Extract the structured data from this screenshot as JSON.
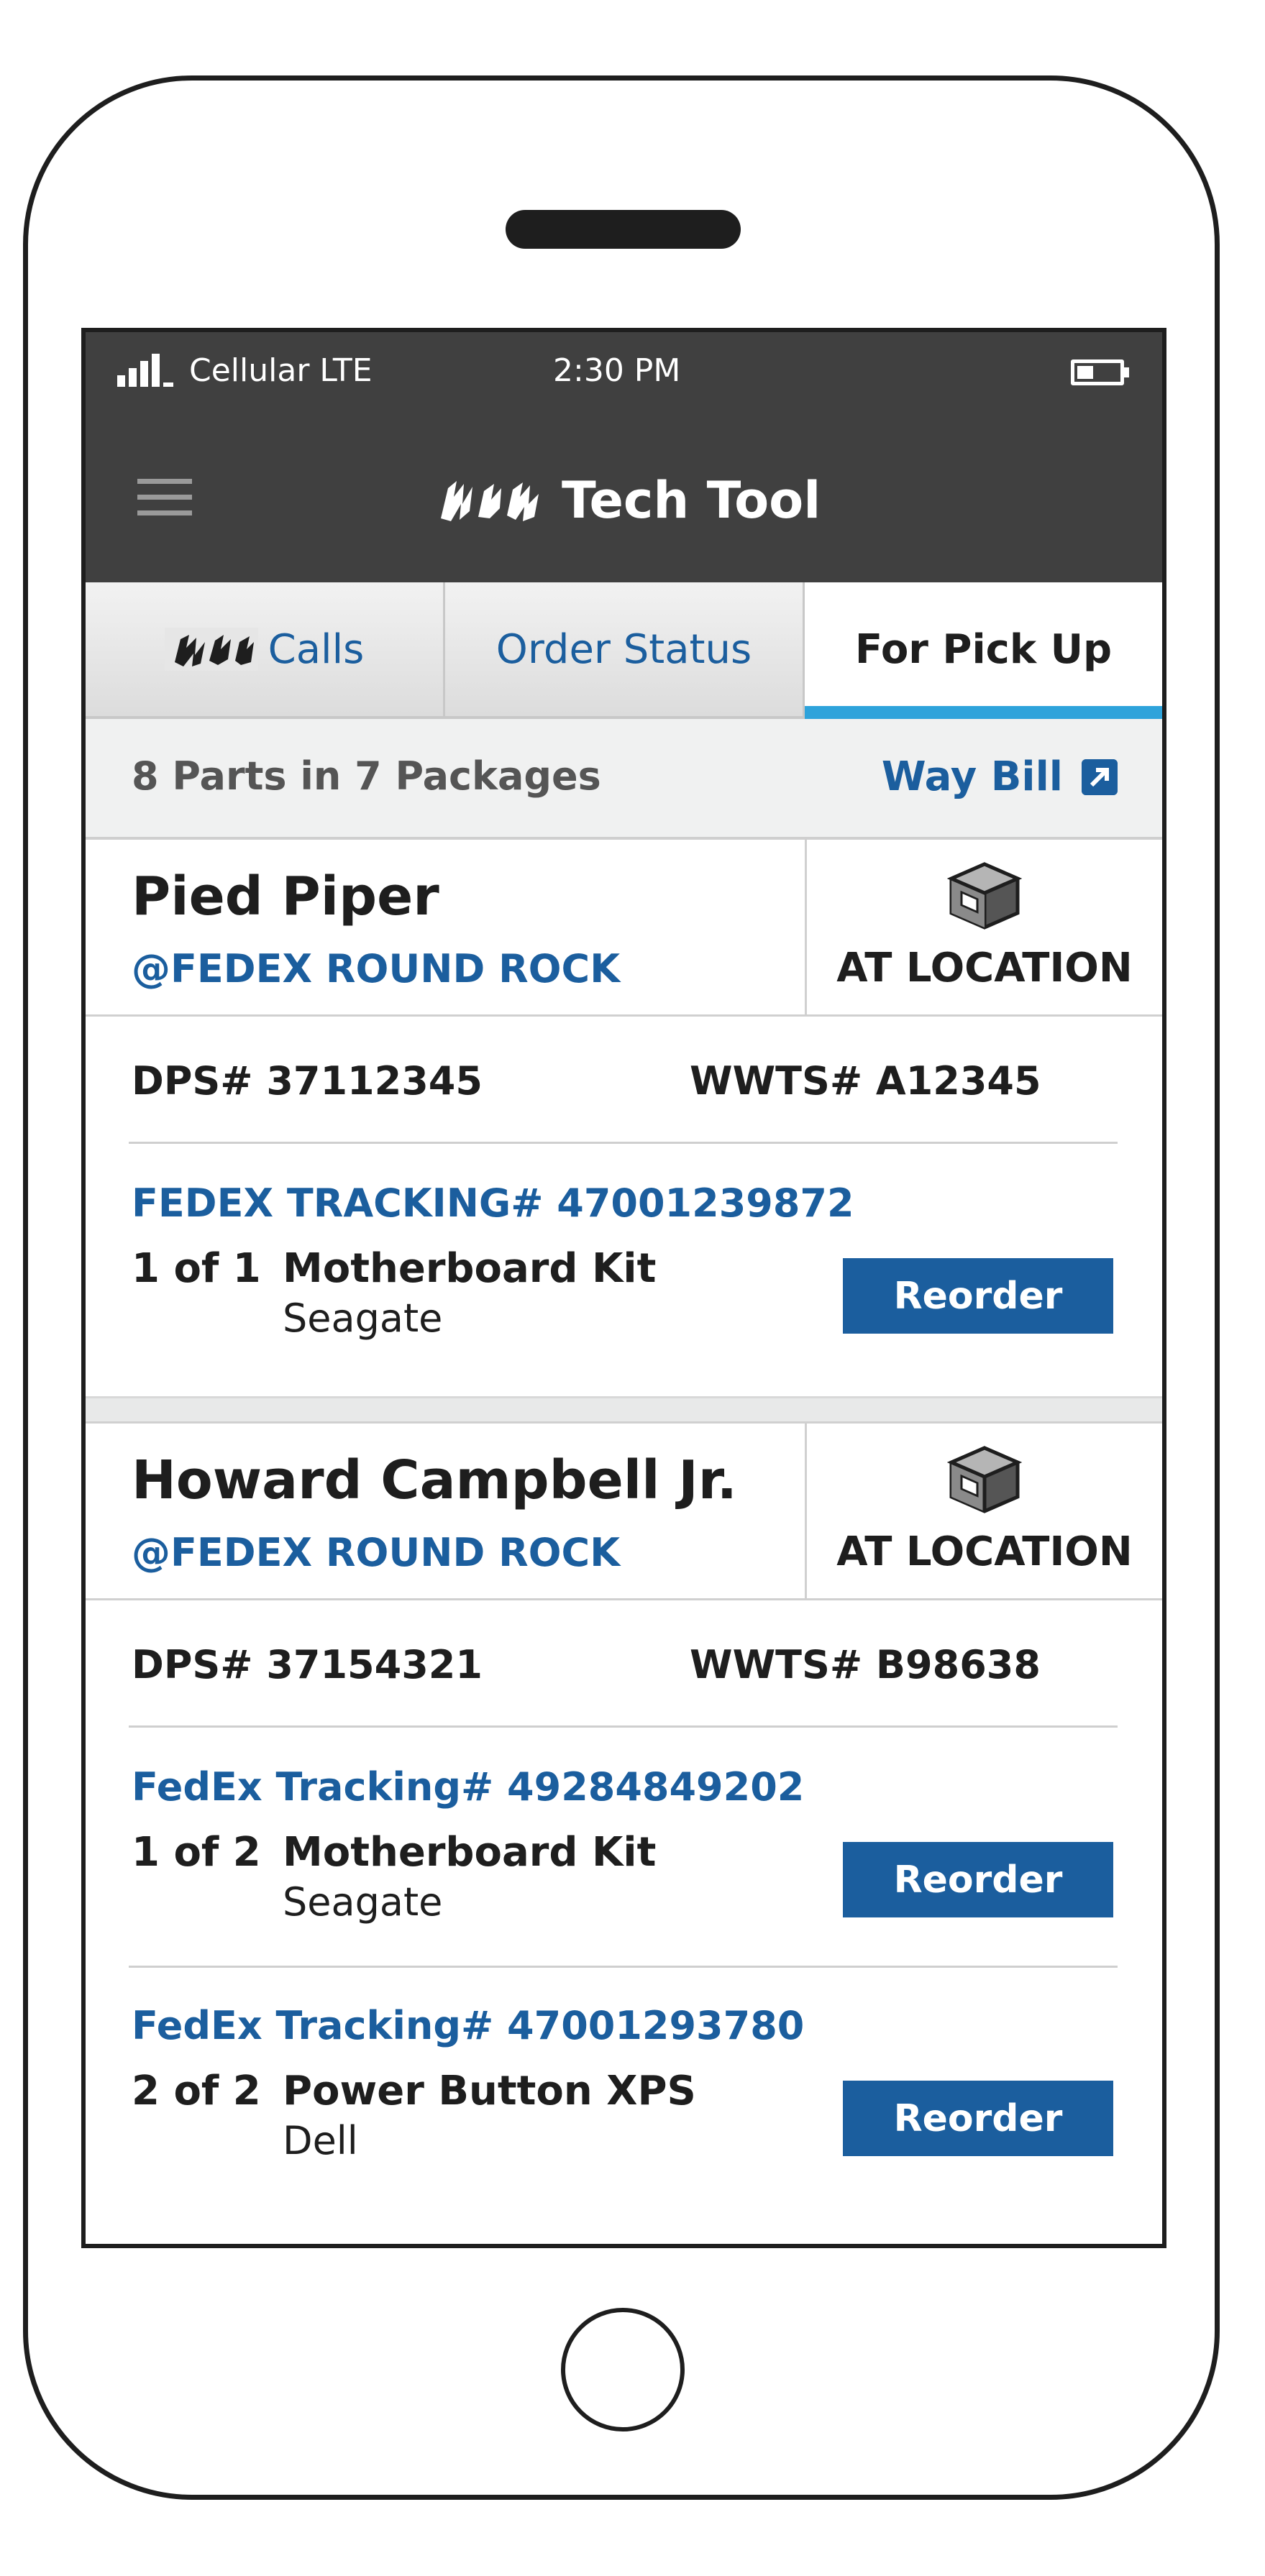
{
  "status_bar": {
    "carrier": "Cellular LTE",
    "time": "2:30 PM"
  },
  "header": {
    "title": "Tech Tool"
  },
  "tabs": [
    {
      "label": "Calls",
      "active": false
    },
    {
      "label": "Order Status",
      "active": false
    },
    {
      "label": "For Pick Up",
      "active": true
    }
  ],
  "summary": {
    "text": "8 Parts in 7 Packages",
    "waybill_label": "Way Bill"
  },
  "colors": {
    "header_bg": "#404040",
    "accent_blue": "#1b5e9e",
    "tab_indicator": "#2ea3db"
  },
  "pickups": [
    {
      "customer": "Pied Piper",
      "location": "@FEDEX ROUND ROCK",
      "status": "AT LOCATION",
      "dps": "DPS# 37112345",
      "wwts": "WWTS# A12345",
      "items": [
        {
          "tracking": "FEDEX TRACKING# 47001239872",
          "count": "1 of 1",
          "part": "Motherboard Kit",
          "vendor": "Seagate",
          "button": "Reorder"
        }
      ]
    },
    {
      "customer": "Howard Campbell Jr.",
      "location": "@FEDEX ROUND ROCK",
      "status": "AT LOCATION",
      "dps": "DPS# 37154321",
      "wwts": "WWTS# B98638",
      "items": [
        {
          "tracking": "FedEx Tracking# 49284849202",
          "count": "1 of 2",
          "part": "Motherboard Kit",
          "vendor": "Seagate",
          "button": "Reorder"
        },
        {
          "tracking": "FedEx Tracking# 47001293780",
          "count": "2 of 2",
          "part": "Power Button XPS",
          "vendor": "Dell",
          "button": "Reorder"
        }
      ]
    }
  ]
}
